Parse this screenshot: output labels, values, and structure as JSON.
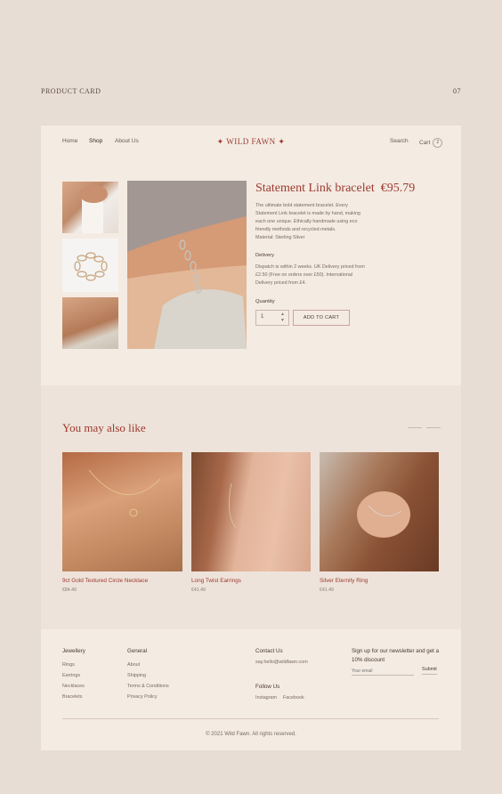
{
  "page": {
    "label": "PRODUCT CARD",
    "number": "07"
  },
  "nav": {
    "links": [
      "Home",
      "Shop",
      "About Us"
    ],
    "brand": "✦ WILD FAWN ✦",
    "search": "Search",
    "cart": "Cart",
    "cart_count": "2"
  },
  "product": {
    "title": "Statement Link bracelet",
    "price": "€95.79",
    "description": [
      "The ultimate bold statement bracelet. Every",
      "Statement Link bracelet is made by hand, making",
      "each one unique. Ethically handmade using eco",
      "friendly methods and recycled metals.",
      "Material: Sterling Silver"
    ],
    "delivery_label": "Delivery",
    "delivery": [
      "Dispatch is within 2 weeks. UK Delivery priced from",
      "£2.50 (Free on orders over £50). International",
      "Delivery priced from £4."
    ],
    "quantity_label": "Quantity",
    "quantity_value": "1",
    "add_to_cart": "ADD TO CART"
  },
  "recommend": {
    "title": "You may also like",
    "items": [
      {
        "name": "9ct Gold Textured Circle Necklace",
        "price": "€84.49"
      },
      {
        "name": "Long Twist Earrings",
        "price": "€41.49"
      },
      {
        "name": "Silver Eternity Ring",
        "price": "€41.49"
      }
    ]
  },
  "footer": {
    "col1": {
      "title": "Jewellery",
      "links": [
        "Rings",
        "Earrings",
        "Necklaces",
        "Bracelets"
      ]
    },
    "col2": {
      "title": "General",
      "links": [
        "About",
        "Shipping",
        "Terms & Conditions",
        "Privacy Policy"
      ]
    },
    "contact": {
      "title": "Contact Us",
      "email": "say.hello@wildfawn.com"
    },
    "follow": {
      "title": "Follow Us",
      "links": [
        "Instagram",
        "Facebook"
      ]
    },
    "newsletter": {
      "title": "Sign up for our newsletter and get a 10% discount",
      "placeholder": "Your email",
      "submit": "Submit"
    },
    "copyright": "© 2021 Wild Fawn. All rights reserved."
  },
  "colors": {
    "accent": "#9c3a2e",
    "page_bg": "#e8ddd4",
    "card_bg": "#f4ebe3"
  }
}
